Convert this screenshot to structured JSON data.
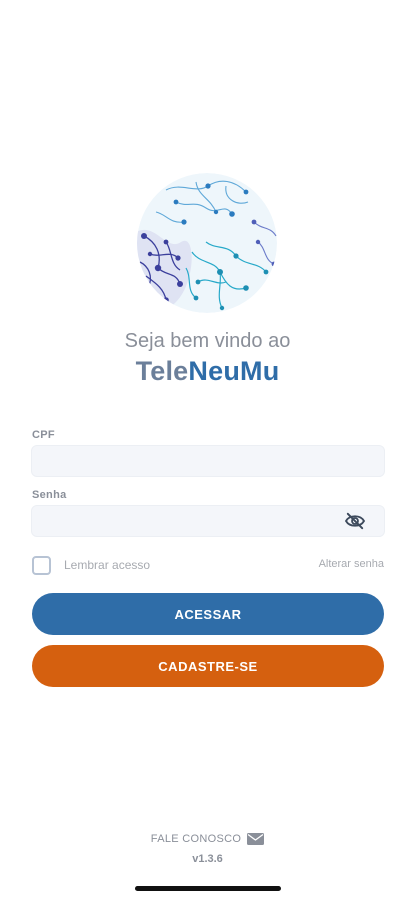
{
  "welcome": {
    "line": "Seja bem vindo ao",
    "brand_prefix": "Tele",
    "brand_suffix": "NeuMu"
  },
  "form": {
    "cpf_label": "CPF",
    "cpf_value": "",
    "password_label": "Senha",
    "password_value": "",
    "remember_label": "Lembrar acesso",
    "remember_checked": false,
    "forgot_label": "Alterar senha"
  },
  "buttons": {
    "access_label": "ACESSAR",
    "signup_label": "CADASTRE-SE"
  },
  "footer": {
    "contact_label": "FALE CONOSCO",
    "version": "v1.3.6"
  },
  "icons": {
    "logo": "neural-globe-logo",
    "password_toggle": "eye-off-icon",
    "contact": "mail-icon"
  },
  "colors": {
    "primary": "#2f6da8",
    "secondary": "#d5600f",
    "brand_prefix": "#6b7f9a",
    "muted_text": "#8a8f99"
  }
}
